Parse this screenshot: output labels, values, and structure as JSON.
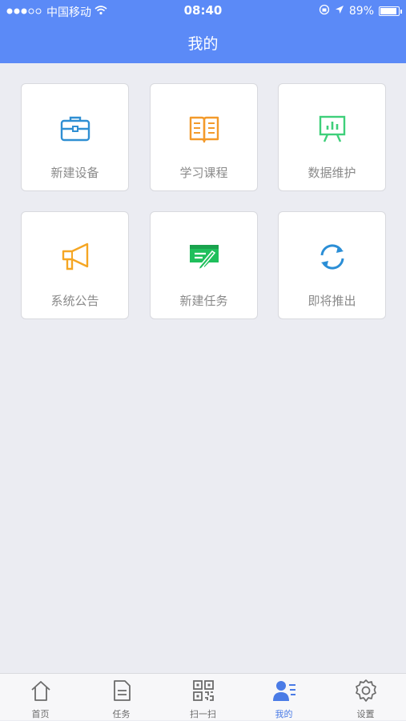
{
  "status_bar": {
    "carrier": "中国移动",
    "time": "08:40",
    "battery": "89%",
    "battery_level": 0.89
  },
  "header": {
    "title": "我的"
  },
  "menu": {
    "items": [
      {
        "label": "新建设备",
        "icon": "briefcase-icon",
        "color": "#2f8fd3"
      },
      {
        "label": "学习课程",
        "icon": "book-icon",
        "color": "#f39a2b"
      },
      {
        "label": "数据维护",
        "icon": "chart-board-icon",
        "color": "#3ecf7a"
      },
      {
        "label": "系统公告",
        "icon": "megaphone-icon",
        "color": "#f5a623"
      },
      {
        "label": "新建任务",
        "icon": "task-edit-icon",
        "color": "#1fbf5c"
      },
      {
        "label": "即将推出",
        "icon": "refresh-icon",
        "color": "#2b8ed6"
      }
    ]
  },
  "tabbar": {
    "tabs": [
      {
        "label": "首页",
        "icon": "home-icon"
      },
      {
        "label": "任务",
        "icon": "document-icon"
      },
      {
        "label": "扫一扫",
        "icon": "qr-code-icon"
      },
      {
        "label": "我的",
        "icon": "user-icon",
        "active": true
      },
      {
        "label": "设置",
        "icon": "gear-icon"
      }
    ],
    "active_color": "#4a7be6"
  }
}
